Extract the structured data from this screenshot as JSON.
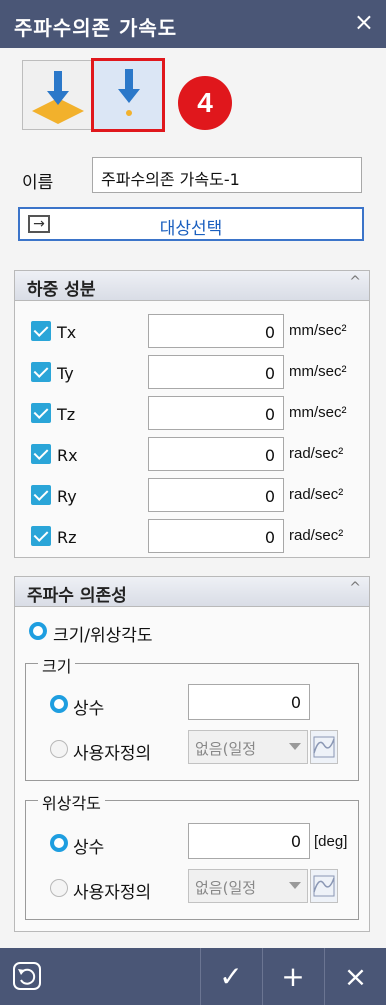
{
  "window": {
    "title": "주파수의존 가속도",
    "close": "×"
  },
  "annotation": {
    "badge": "4"
  },
  "name_row": {
    "label": "이름",
    "value": "주파수의존 가속도-1"
  },
  "select_target": {
    "label": "대상선택"
  },
  "load_panel": {
    "title": "하중 성분",
    "rows": [
      {
        "label": "Tx",
        "value": "0",
        "unit": "mm/sec²"
      },
      {
        "label": "Ty",
        "value": "0",
        "unit": "mm/sec²"
      },
      {
        "label": "Tz",
        "value": "0",
        "unit": "mm/sec²"
      },
      {
        "label": "Rx",
        "value": "0",
        "unit": "rad/sec²"
      },
      {
        "label": "Ry",
        "value": "0",
        "unit": "rad/sec²"
      },
      {
        "label": "Rz",
        "value": "0",
        "unit": "rad/sec²"
      }
    ]
  },
  "freq_panel": {
    "title": "주파수 의존성",
    "mode_label": "크기/위상각도",
    "magnitude": {
      "title": "크기",
      "constant_label": "상수",
      "constant_value": "0",
      "user_label": "사용자정의",
      "dropdown_value": "없음(일정"
    },
    "phase": {
      "title": "위상각도",
      "constant_label": "상수",
      "constant_value": "0",
      "unit": "[deg]",
      "user_label": "사용자정의",
      "dropdown_value": "없음(일정"
    }
  },
  "bottom": {
    "ok": "✓",
    "add": "+",
    "cancel": "×"
  }
}
